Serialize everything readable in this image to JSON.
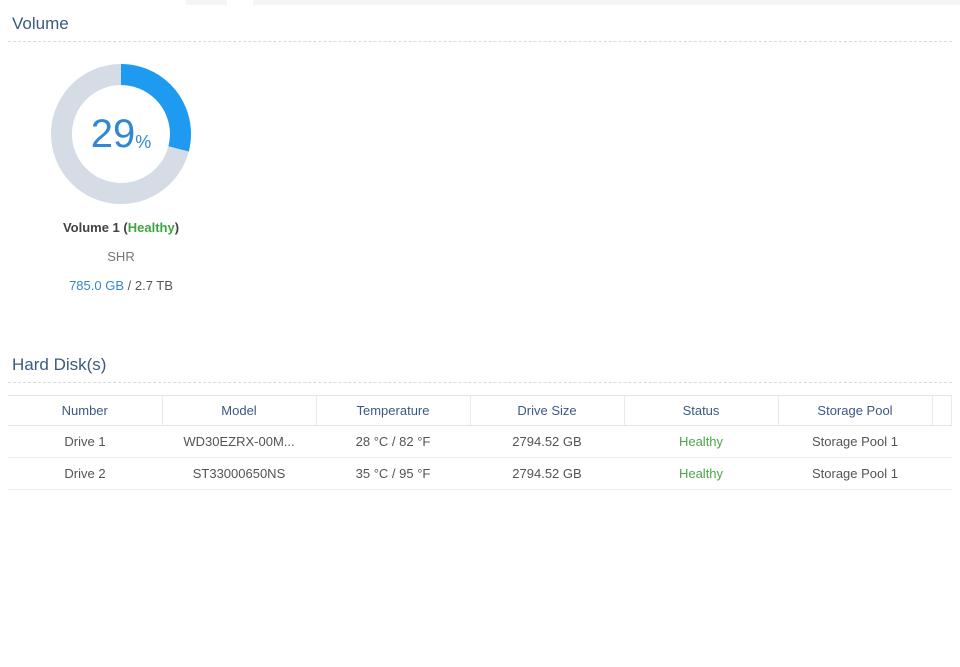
{
  "volume_section": {
    "title": "Volume",
    "donut": {
      "type": "donut",
      "percent": 29,
      "percent_label": "29",
      "percent_suffix": "%",
      "used_color": "#1e9bf0",
      "track_color": "#d5dce5"
    },
    "name_prefix": "Volume 1 (",
    "status": "Healthy",
    "name_suffix": ")",
    "raid_type": "SHR",
    "used_text": "785.0 GB",
    "total_text": " / 2.7 TB"
  },
  "disks_section": {
    "title": "Hard Disk(s)",
    "table": {
      "columns": [
        "Number",
        "Model",
        "Temperature",
        "Drive Size",
        "Status",
        "Storage Pool"
      ],
      "rows": [
        {
          "number": "Drive 1",
          "model": "WD30EZRX-00M...",
          "temperature": "28 °C / 82 °F",
          "drive_size": "2794.52 GB",
          "status": "Healthy",
          "storage_pool": "Storage Pool 1"
        },
        {
          "number": "Drive 2",
          "model": "ST33000650NS",
          "temperature": "35 °C / 95 °F",
          "drive_size": "2794.52 GB",
          "status": "Healthy",
          "storage_pool": "Storage Pool 1"
        }
      ]
    }
  },
  "colors": {
    "heading_blue": "#3b5a80",
    "donut_used": "#1e9bf0",
    "donut_track": "#d5dce5",
    "percent_text": "#3187d3",
    "healthy_green_label": "#3fa53f",
    "healthy_green_table": "#4da64a",
    "used_blue": "#3787cd"
  }
}
